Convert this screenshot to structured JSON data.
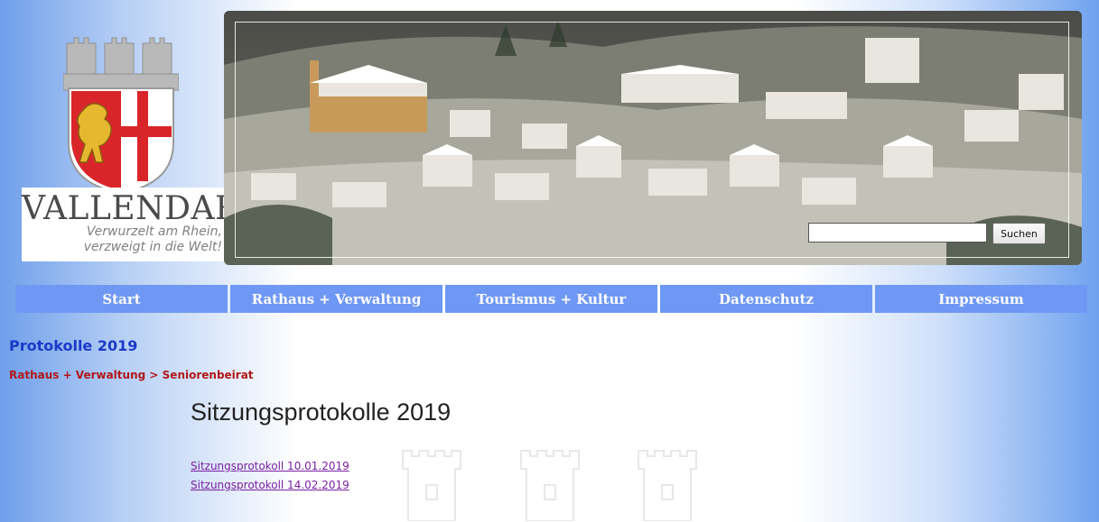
{
  "logo": {
    "title": "VALLENDAR",
    "tagline_line1": "Verwurzelt am Rhein,",
    "tagline_line2": "verzweigt in die Welt!"
  },
  "search": {
    "placeholder": "",
    "value": "",
    "button_label": "Suchen"
  },
  "nav": {
    "items": [
      {
        "label": "Start"
      },
      {
        "label": "Rathaus + Verwaltung"
      },
      {
        "label": "Tourismus + Kultur"
      },
      {
        "label": "Datenschutz"
      },
      {
        "label": "Impressum"
      }
    ]
  },
  "page": {
    "title": "Protokolle 2019",
    "breadcrumb": {
      "parent": "Rathaus + Verwaltung",
      "separator": ">",
      "current": "Seniorenbeirat"
    },
    "heading": "Sitzungsprotokolle 2019",
    "documents": [
      {
        "label": "Sitzungsprotokoll 10.01.2019"
      },
      {
        "label": "Sitzungsprotokoll 14.02.2019"
      }
    ]
  },
  "colors": {
    "nav_bg": "#6f98f4",
    "title": "#1a3ac8",
    "breadcrumb": "#b01818",
    "link": "#7a1fa2"
  }
}
